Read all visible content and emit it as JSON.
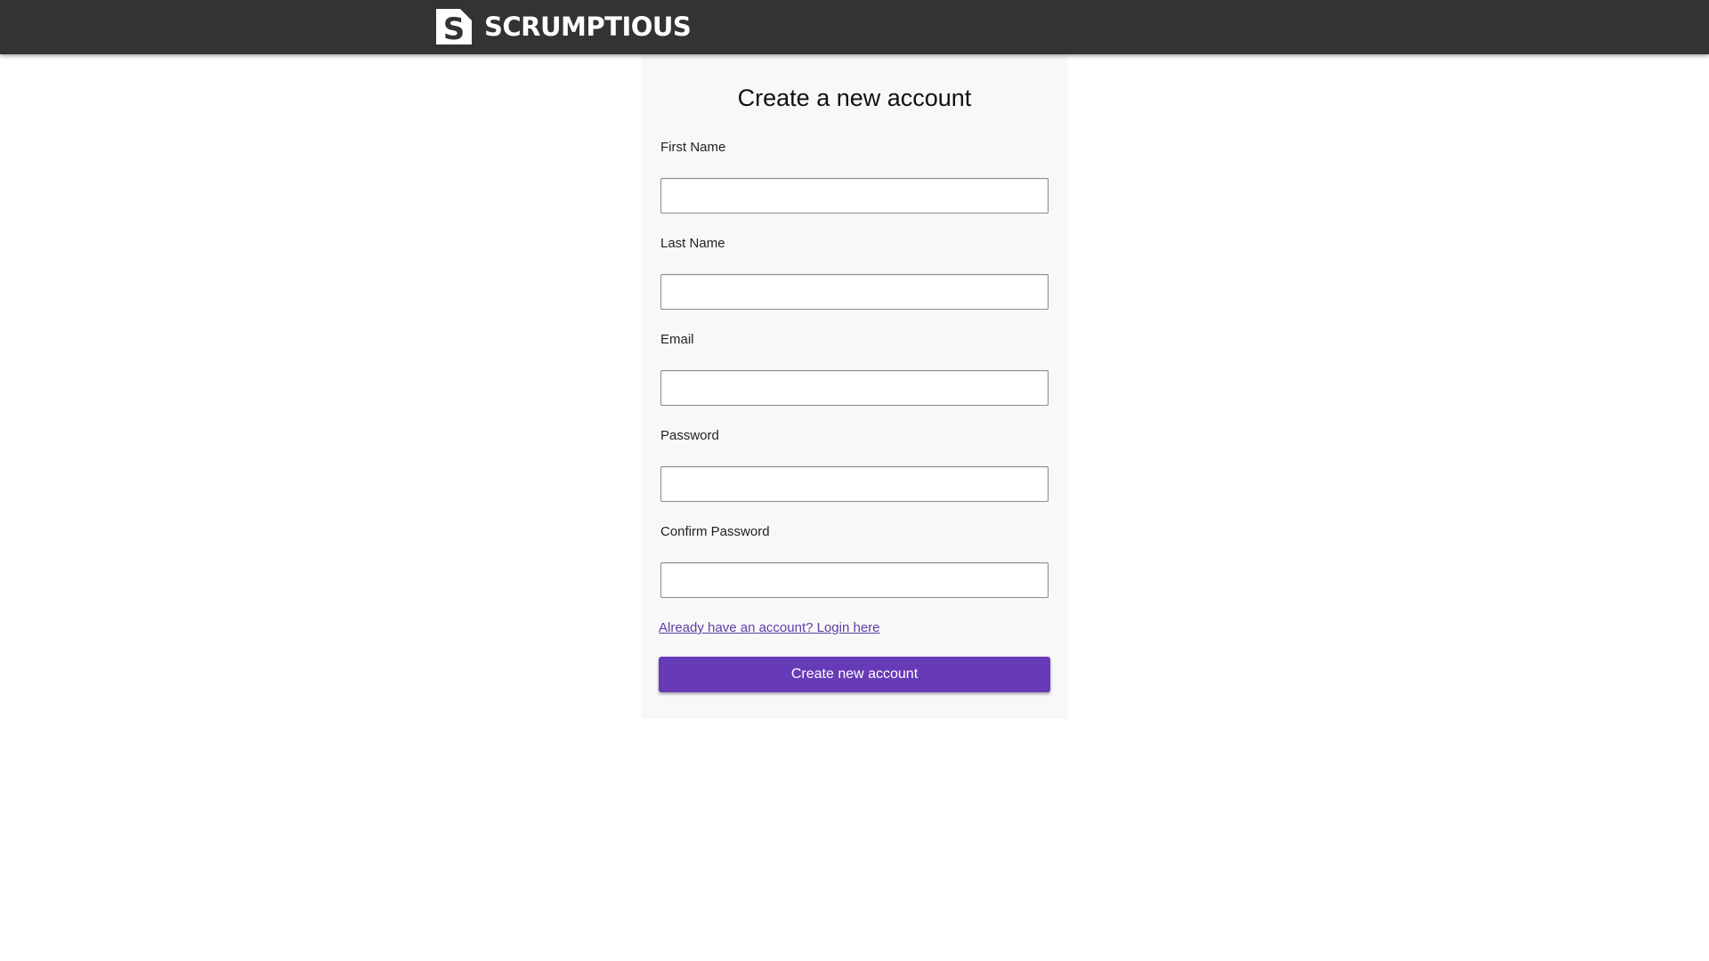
{
  "header": {
    "brand_name": "SCRUMPTIOUS",
    "logo_icon": "s-logo-icon",
    "background_color": "#333333"
  },
  "form": {
    "title": "Create a new account",
    "fields": [
      {
        "label": "First Name",
        "value": "",
        "type": "text"
      },
      {
        "label": "Last Name",
        "value": "",
        "type": "text"
      },
      {
        "label": "Email",
        "value": "",
        "type": "email"
      },
      {
        "label": "Password",
        "value": "",
        "type": "password"
      },
      {
        "label": "Confirm Password",
        "value": "",
        "type": "password"
      }
    ],
    "login_link": "Already have an account? Login here",
    "submit_label": "Create new account",
    "accent_color": "#673ab7",
    "link_color": "#5b3fa6"
  }
}
